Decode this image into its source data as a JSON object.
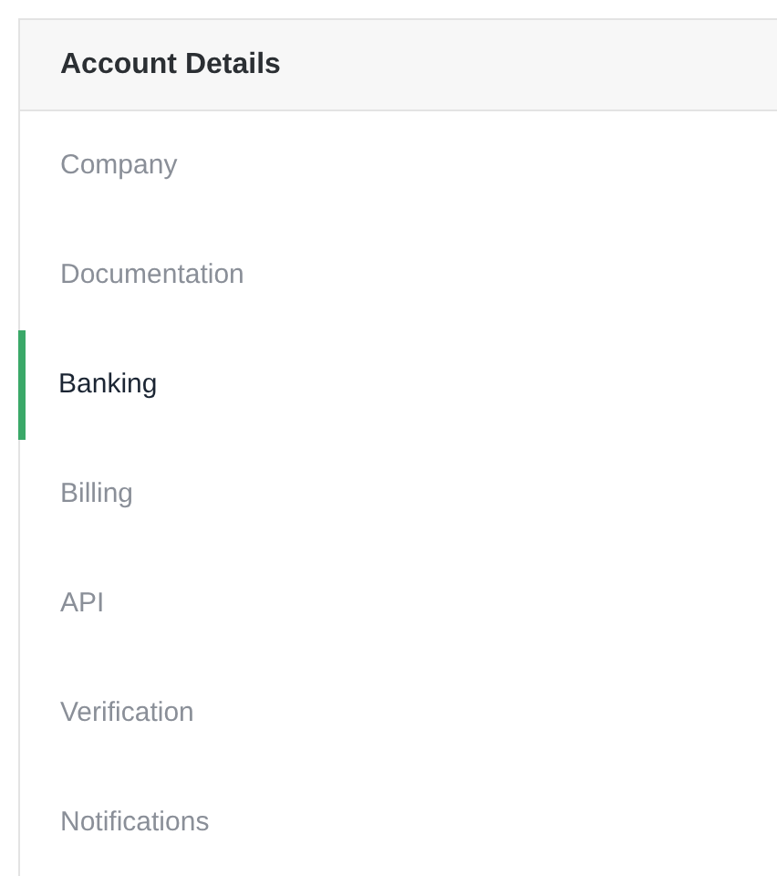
{
  "panel": {
    "title": "Account Details"
  },
  "items": [
    {
      "label": "Company",
      "selected": false
    },
    {
      "label": "Documentation",
      "selected": false
    },
    {
      "label": "Banking",
      "selected": true
    },
    {
      "label": "Billing",
      "selected": false
    },
    {
      "label": "API",
      "selected": false
    },
    {
      "label": "Verification",
      "selected": false
    },
    {
      "label": "Notifications",
      "selected": false
    }
  ]
}
